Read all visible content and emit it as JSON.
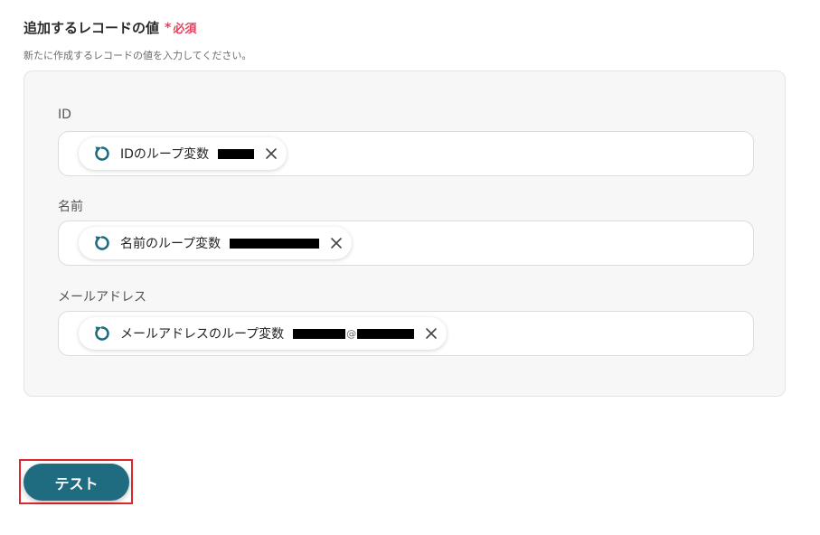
{
  "section": {
    "title": "追加するレコードの値",
    "required_mark": "*",
    "required_label": "必須",
    "description": "新たに作成するレコードの値を入力してください。"
  },
  "fields": [
    {
      "label": "ID",
      "chip_text": "IDのループ変数"
    },
    {
      "label": "名前",
      "chip_text": "名前のループ変数"
    },
    {
      "label": "メールアドレス",
      "chip_text": "メールアドレスのループ変数",
      "at_sign": "@"
    }
  ],
  "actions": {
    "test_label": "テスト"
  },
  "colors": {
    "accent": "#1f6b80",
    "required": "#e5405e",
    "highlight_frame": "#e0262c"
  },
  "icons": {
    "chip": "loop-icon",
    "remove": "close-icon"
  }
}
